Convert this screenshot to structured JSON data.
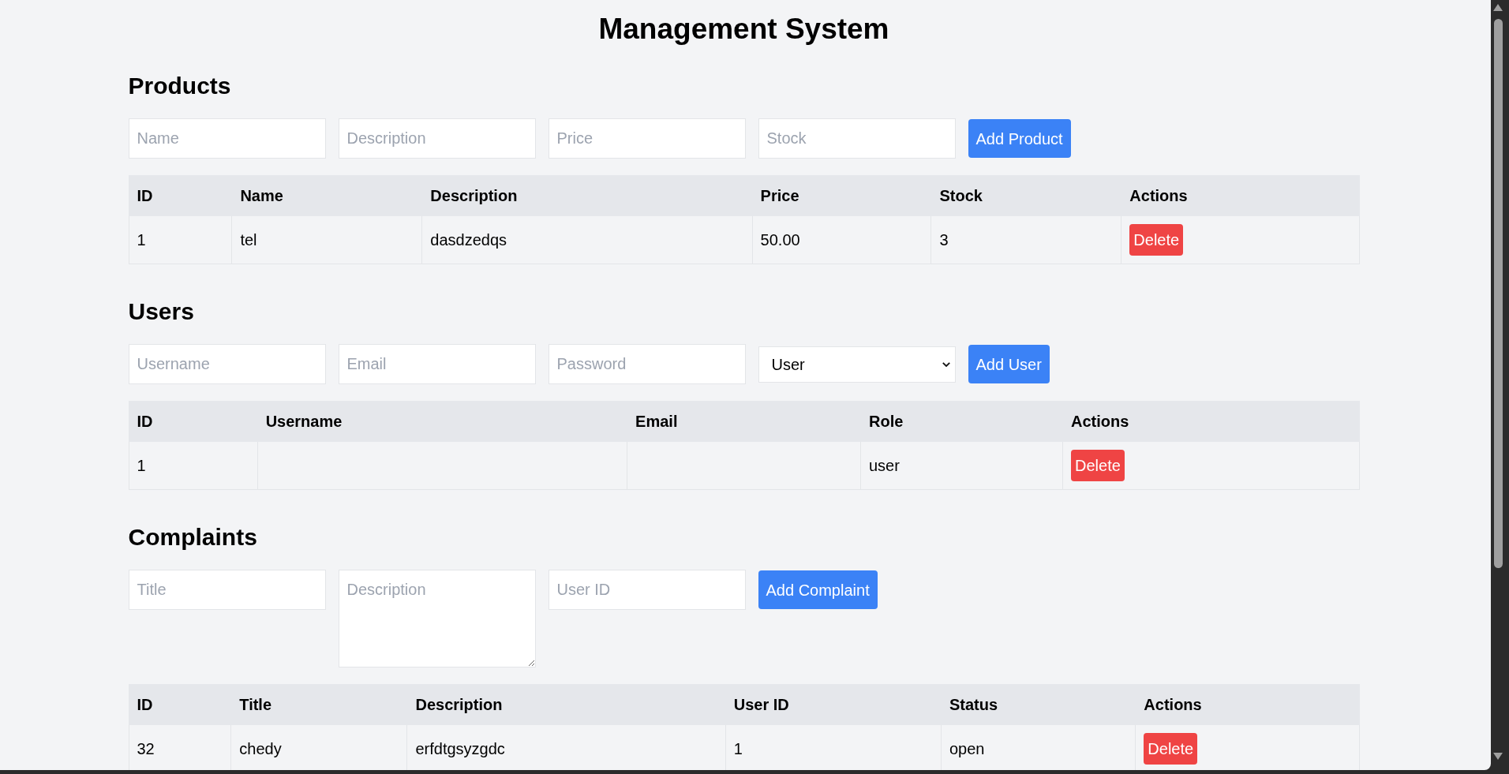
{
  "title": "Management System",
  "sections": [
    {
      "heading": "Products",
      "form": {
        "fields": [
          {
            "kind": "input",
            "placeholder": "Name"
          },
          {
            "kind": "input",
            "placeholder": "Description"
          },
          {
            "kind": "input",
            "placeholder": "Price"
          },
          {
            "kind": "input",
            "placeholder": "Stock"
          }
        ],
        "button": "Add Product"
      },
      "table": {
        "columns": [
          "ID",
          "Name",
          "Description",
          "Price",
          "Stock",
          "Actions"
        ],
        "rows": [
          {
            "cells": [
              "1",
              "tel",
              "dasdzedqs",
              "50.00",
              "3"
            ],
            "actions": [
              "Delete"
            ]
          }
        ]
      }
    },
    {
      "heading": "Users",
      "form": {
        "fields": [
          {
            "kind": "input",
            "placeholder": "Username"
          },
          {
            "kind": "input",
            "placeholder": "Email"
          },
          {
            "kind": "input",
            "placeholder": "Password"
          },
          {
            "kind": "select",
            "value": "User"
          }
        ],
        "button": "Add User"
      },
      "table": {
        "columns": [
          "ID",
          "Username",
          "Email",
          "Role",
          "Actions"
        ],
        "rows": [
          {
            "cells": [
              "1",
              null,
              null,
              "user"
            ],
            "actions": [
              "Delete"
            ]
          }
        ]
      }
    },
    {
      "heading": "Complaints",
      "form": {
        "fields": [
          {
            "kind": "input",
            "placeholder": "Title"
          },
          {
            "kind": "textarea",
            "placeholder": "Description"
          },
          {
            "kind": "input",
            "placeholder": "User ID"
          }
        ],
        "button": "Add Complaint"
      },
      "table": {
        "columns": [
          "ID",
          "Title",
          "Description",
          "User ID",
          "Status",
          "Actions"
        ],
        "rows": [
          {
            "cells": [
              "32",
              "chedy",
              "erfdtgsyzgdc",
              "1",
              "open"
            ],
            "actions": [
              "Delete"
            ]
          }
        ]
      }
    }
  ]
}
